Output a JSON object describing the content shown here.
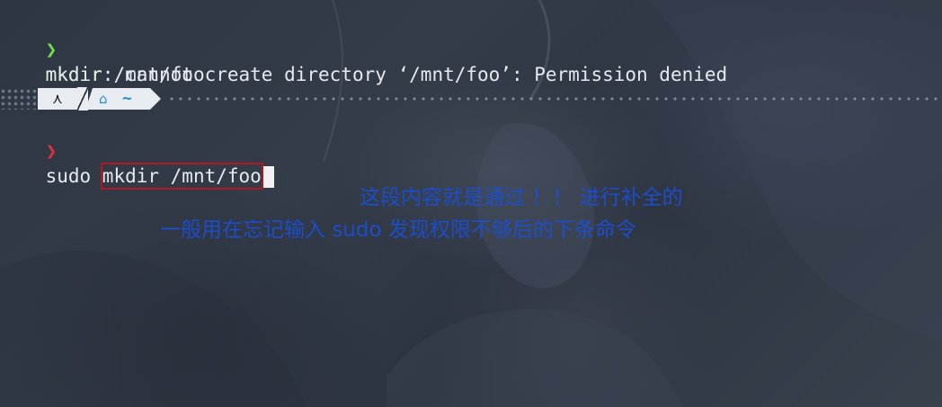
{
  "terminal": {
    "line1": {
      "prompt_symbol": "❯",
      "command": "mkdir",
      "args": " /mnt/foo"
    },
    "line2": {
      "output": "mkdir: cannot create directory ‘/mnt/foo’: Permission denied"
    },
    "statusbar": {
      "os_icon": "⋏",
      "home_icon": "⌂",
      "dir": "~"
    },
    "line3": {
      "prompt_symbol": "❯",
      "typed": "sudo ",
      "suggestion": "mkdir /mnt/foo"
    }
  },
  "annotation": {
    "line1": "这段内容就是通过 ！！ 进行补全的",
    "line2": "一般用在忘记输入 sudo 发现权限不够后的下条命令"
  },
  "colors": {
    "prompt_ok": "#6fe04a",
    "prompt_err": "#e0303a",
    "highlight_box": "#b3181e",
    "annotation_text": "#1b4fd6",
    "statusbar_accent": "#1f8fd8"
  }
}
